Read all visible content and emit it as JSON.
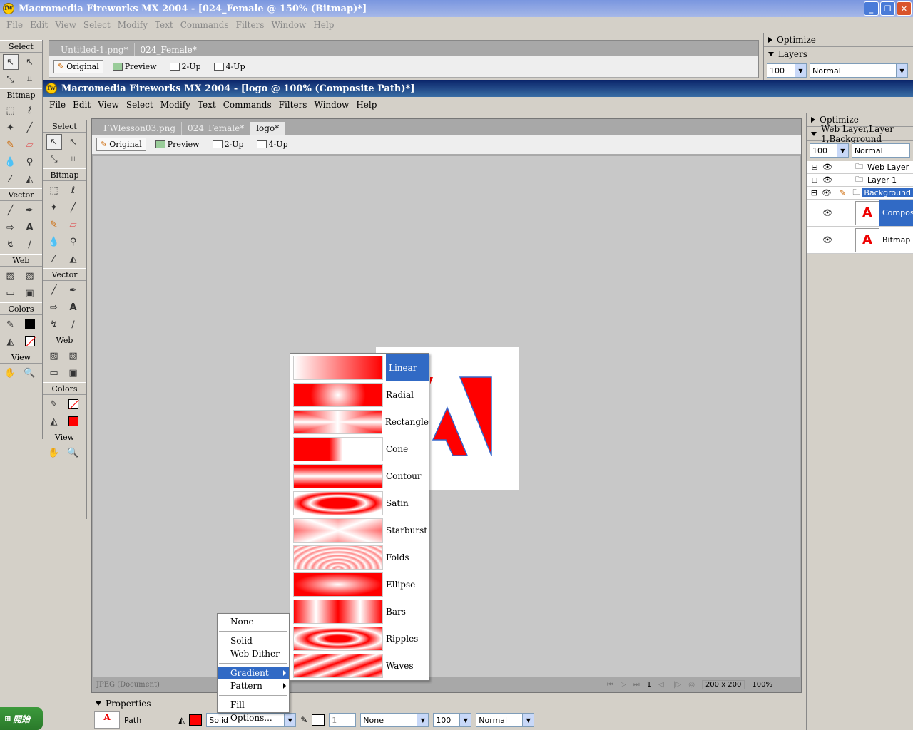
{
  "outer_window": {
    "title": "Macromedia Fireworks MX 2004 - [024_Female @ 150% (Bitmap)*]",
    "menu": [
      "File",
      "Edit",
      "View",
      "Select",
      "Modify",
      "Text",
      "Commands",
      "Filters",
      "Window",
      "Help"
    ],
    "tabs": [
      "Untitled-1.png*",
      "024_Female*"
    ],
    "view_buttons": [
      "Original",
      "Preview",
      "2-Up",
      "4-Up"
    ]
  },
  "outer_panel": {
    "optimize": "Optimize",
    "layers": "Layers",
    "opacity": "100",
    "blend": "Normal"
  },
  "outer_tools": {
    "sections": [
      "Select",
      "Bitmap",
      "Vector",
      "Web",
      "Colors",
      "View"
    ]
  },
  "inner_window": {
    "title": "Macromedia Fireworks MX 2004 - [logo @ 100% (Composite Path)*]",
    "menu": [
      "File",
      "Edit",
      "View",
      "Select",
      "Modify",
      "Text",
      "Commands",
      "Filters",
      "Window",
      "Help"
    ],
    "tabs": [
      "FWlesson03.png",
      "024_Female*",
      "logo*"
    ],
    "view_buttons": [
      "Original",
      "Preview",
      "2-Up",
      "4-Up"
    ]
  },
  "inner_tools": {
    "sections": [
      "Select",
      "Bitmap",
      "Vector",
      "Web",
      "Colors",
      "View"
    ]
  },
  "layers_panel": {
    "optimize": "Optimize",
    "layers": [
      "Web Layer",
      "Layer 1",
      "Background"
    ],
    "opacity": "100",
    "blend": "Normal",
    "objects": [
      "Composite Path",
      "Bitmap"
    ]
  },
  "status": {
    "doc_type": "JPEG (Document)",
    "frame": "1",
    "size": "200 x 200",
    "zoom": "100%"
  },
  "properties": {
    "title": "Properties",
    "object_type": "Path",
    "fill_type": "Solid",
    "stroke_width": "1",
    "stroke_type": "None",
    "opacity": "100",
    "blend": "Normal"
  },
  "fill_menu": {
    "items": [
      "None",
      "Solid",
      "Web Dither",
      "Gradient",
      "Pattern",
      "Fill Options..."
    ]
  },
  "gradient_menu": {
    "items": [
      "Linear",
      "Radial",
      "Rectangle",
      "Cone",
      "Contour",
      "Satin",
      "Starburst",
      "Folds",
      "Ellipse",
      "Bars",
      "Ripples",
      "Waves"
    ]
  },
  "taskbar": {
    "start": "開始"
  },
  "colors": {
    "accent": "#316ac5",
    "fill": "#ff0000",
    "canvas_bg": "#c8c8c8"
  }
}
